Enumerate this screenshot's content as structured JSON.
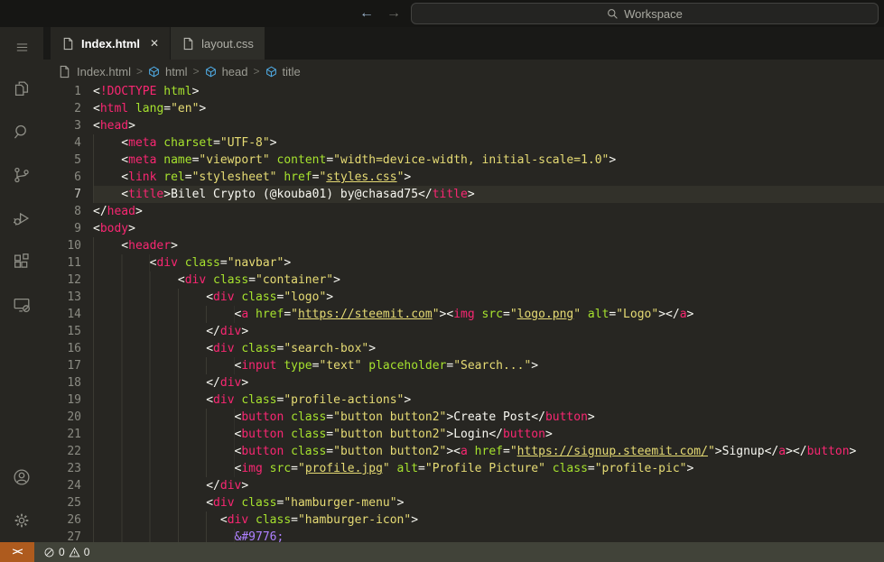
{
  "title_bar": {
    "back_glyph": "←",
    "forward_glyph": "→",
    "search_label": "Workspace"
  },
  "tabs": [
    {
      "label": "Index.html",
      "active": true,
      "icon": "file-icon",
      "close_glyph": "✕"
    },
    {
      "label": "layout.css",
      "active": false,
      "icon": "file-icon"
    }
  ],
  "breadcrumb": {
    "file": "Index.html",
    "separator": ">",
    "symbols": [
      "html",
      "head",
      "title"
    ]
  },
  "activity_bar": {
    "top_items": [
      "menu",
      "explorer",
      "search",
      "source-control",
      "run-debug",
      "extensions",
      "remote-explorer"
    ],
    "bottom_items": [
      "account",
      "settings"
    ]
  },
  "status_bar": {
    "remote_glyph": "><",
    "errors": "0",
    "warnings": "0"
  },
  "editor": {
    "current_line": 7,
    "lines": [
      {
        "n": 1,
        "indent": 0,
        "tokens": [
          [
            "p",
            "<"
          ],
          [
            "tag",
            "!DOCTYPE"
          ],
          [
            "attr",
            " html"
          ],
          [
            "p",
            ">"
          ]
        ]
      },
      {
        "n": 2,
        "indent": 0,
        "tokens": [
          [
            "p",
            "<"
          ],
          [
            "tag",
            "html"
          ],
          [
            "attr",
            " lang"
          ],
          [
            "p",
            "="
          ],
          [
            "str",
            "\"en\""
          ],
          [
            "p",
            ">"
          ]
        ]
      },
      {
        "n": 3,
        "indent": 0,
        "tokens": [
          [
            "p",
            "<"
          ],
          [
            "tag",
            "head"
          ],
          [
            "p",
            ">"
          ]
        ]
      },
      {
        "n": 4,
        "indent": 4,
        "tokens": [
          [
            "p",
            "<"
          ],
          [
            "tag",
            "meta"
          ],
          [
            "attr",
            " charset"
          ],
          [
            "p",
            "="
          ],
          [
            "str",
            "\"UTF-8\""
          ],
          [
            "p",
            ">"
          ]
        ]
      },
      {
        "n": 5,
        "indent": 4,
        "tokens": [
          [
            "p",
            "<"
          ],
          [
            "tag",
            "meta"
          ],
          [
            "attr",
            " name"
          ],
          [
            "p",
            "="
          ],
          [
            "str",
            "\"viewport\""
          ],
          [
            "attr",
            " content"
          ],
          [
            "p",
            "="
          ],
          [
            "str",
            "\"width=device-width, initial-scale=1.0\""
          ],
          [
            "p",
            ">"
          ]
        ]
      },
      {
        "n": 6,
        "indent": 4,
        "tokens": [
          [
            "p",
            "<"
          ],
          [
            "tag",
            "link"
          ],
          [
            "attr",
            " rel"
          ],
          [
            "p",
            "="
          ],
          [
            "str",
            "\"stylesheet\""
          ],
          [
            "attr",
            " href"
          ],
          [
            "p",
            "="
          ],
          [
            "str",
            "\""
          ],
          [
            "link",
            "styles.css"
          ],
          [
            "str",
            "\""
          ],
          [
            "p",
            ">"
          ]
        ]
      },
      {
        "n": 7,
        "indent": 4,
        "tokens": [
          [
            "p",
            "<"
          ],
          [
            "tag",
            "title"
          ],
          [
            "p",
            ">"
          ],
          [
            "text",
            "Bilel Crypto (@kouba01) by@chasad75"
          ],
          [
            "p",
            "</"
          ],
          [
            "tag",
            "title"
          ],
          [
            "p",
            ">"
          ]
        ]
      },
      {
        "n": 8,
        "indent": 0,
        "tokens": [
          [
            "p",
            "</"
          ],
          [
            "tag",
            "head"
          ],
          [
            "p",
            ">"
          ]
        ]
      },
      {
        "n": 9,
        "indent": 0,
        "tokens": [
          [
            "p",
            "<"
          ],
          [
            "tag",
            "body"
          ],
          [
            "p",
            ">"
          ]
        ]
      },
      {
        "n": 10,
        "indent": 4,
        "tokens": [
          [
            "p",
            "<"
          ],
          [
            "tag",
            "header"
          ],
          [
            "p",
            ">"
          ]
        ]
      },
      {
        "n": 11,
        "indent": 8,
        "tokens": [
          [
            "p",
            "<"
          ],
          [
            "tag",
            "div"
          ],
          [
            "attr",
            " class"
          ],
          [
            "p",
            "="
          ],
          [
            "str",
            "\"navbar\""
          ],
          [
            "p",
            ">"
          ]
        ]
      },
      {
        "n": 12,
        "indent": 12,
        "tokens": [
          [
            "p",
            "<"
          ],
          [
            "tag",
            "div"
          ],
          [
            "attr",
            " class"
          ],
          [
            "p",
            "="
          ],
          [
            "str",
            "\"container\""
          ],
          [
            "p",
            ">"
          ]
        ]
      },
      {
        "n": 13,
        "indent": 16,
        "tokens": [
          [
            "p",
            "<"
          ],
          [
            "tag",
            "div"
          ],
          [
            "attr",
            " class"
          ],
          [
            "p",
            "="
          ],
          [
            "str",
            "\"logo\""
          ],
          [
            "p",
            ">"
          ]
        ]
      },
      {
        "n": 14,
        "indent": 20,
        "tokens": [
          [
            "p",
            "<"
          ],
          [
            "tag",
            "a"
          ],
          [
            "attr",
            " href"
          ],
          [
            "p",
            "="
          ],
          [
            "str",
            "\""
          ],
          [
            "link",
            "https://steemit.com"
          ],
          [
            "str",
            "\""
          ],
          [
            "p",
            "><"
          ],
          [
            "tag",
            "img"
          ],
          [
            "attr",
            " src"
          ],
          [
            "p",
            "="
          ],
          [
            "str",
            "\""
          ],
          [
            "link",
            "logo.png"
          ],
          [
            "str",
            "\""
          ],
          [
            "attr",
            " alt"
          ],
          [
            "p",
            "="
          ],
          [
            "str",
            "\"Logo\""
          ],
          [
            "p",
            "></"
          ],
          [
            "tag",
            "a"
          ],
          [
            "p",
            ">"
          ]
        ]
      },
      {
        "n": 15,
        "indent": 16,
        "tokens": [
          [
            "p",
            "</"
          ],
          [
            "tag",
            "div"
          ],
          [
            "p",
            ">"
          ]
        ]
      },
      {
        "n": 16,
        "indent": 16,
        "tokens": [
          [
            "p",
            "<"
          ],
          [
            "tag",
            "div"
          ],
          [
            "attr",
            " class"
          ],
          [
            "p",
            "="
          ],
          [
            "str",
            "\"search-box\""
          ],
          [
            "p",
            ">"
          ]
        ]
      },
      {
        "n": 17,
        "indent": 20,
        "tokens": [
          [
            "p",
            "<"
          ],
          [
            "tag",
            "input"
          ],
          [
            "attr",
            " type"
          ],
          [
            "p",
            "="
          ],
          [
            "str",
            "\"text\""
          ],
          [
            "attr",
            " placeholder"
          ],
          [
            "p",
            "="
          ],
          [
            "str",
            "\"Search...\""
          ],
          [
            "p",
            ">"
          ]
        ]
      },
      {
        "n": 18,
        "indent": 16,
        "tokens": [
          [
            "p",
            "</"
          ],
          [
            "tag",
            "div"
          ],
          [
            "p",
            ">"
          ]
        ]
      },
      {
        "n": 19,
        "indent": 16,
        "tokens": [
          [
            "p",
            "<"
          ],
          [
            "tag",
            "div"
          ],
          [
            "attr",
            " class"
          ],
          [
            "p",
            "="
          ],
          [
            "str",
            "\"profile-actions\""
          ],
          [
            "p",
            ">"
          ]
        ]
      },
      {
        "n": 20,
        "indent": 20,
        "tokens": [
          [
            "p",
            "<"
          ],
          [
            "tag",
            "button"
          ],
          [
            "attr",
            " class"
          ],
          [
            "p",
            "="
          ],
          [
            "str",
            "\"button button2\""
          ],
          [
            "p",
            ">"
          ],
          [
            "text",
            "Create Post"
          ],
          [
            "p",
            "</"
          ],
          [
            "tag",
            "button"
          ],
          [
            "p",
            ">"
          ]
        ]
      },
      {
        "n": 21,
        "indent": 20,
        "tokens": [
          [
            "p",
            "<"
          ],
          [
            "tag",
            "button"
          ],
          [
            "attr",
            " class"
          ],
          [
            "p",
            "="
          ],
          [
            "str",
            "\"button button2\""
          ],
          [
            "p",
            ">"
          ],
          [
            "text",
            "Login"
          ],
          [
            "p",
            "</"
          ],
          [
            "tag",
            "button"
          ],
          [
            "p",
            ">"
          ]
        ]
      },
      {
        "n": 22,
        "indent": 20,
        "tokens": [
          [
            "p",
            "<"
          ],
          [
            "tag",
            "button"
          ],
          [
            "attr",
            " class"
          ],
          [
            "p",
            "="
          ],
          [
            "str",
            "\"button button2\""
          ],
          [
            "p",
            "><"
          ],
          [
            "tag",
            "a"
          ],
          [
            "attr",
            " href"
          ],
          [
            "p",
            "="
          ],
          [
            "str",
            "\""
          ],
          [
            "link",
            "https://signup.steemit.com/"
          ],
          [
            "str",
            "\""
          ],
          [
            "p",
            ">"
          ],
          [
            "text",
            "Signup"
          ],
          [
            "p",
            "</"
          ],
          [
            "tag",
            "a"
          ],
          [
            "p",
            "></"
          ],
          [
            "tag",
            "button"
          ],
          [
            "p",
            ">"
          ]
        ]
      },
      {
        "n": 23,
        "indent": 20,
        "tokens": [
          [
            "p",
            "<"
          ],
          [
            "tag",
            "img"
          ],
          [
            "attr",
            " src"
          ],
          [
            "p",
            "="
          ],
          [
            "str",
            "\""
          ],
          [
            "link",
            "profile.jpg"
          ],
          [
            "str",
            "\""
          ],
          [
            "attr",
            " alt"
          ],
          [
            "p",
            "="
          ],
          [
            "str",
            "\"Profile Picture\""
          ],
          [
            "attr",
            " class"
          ],
          [
            "p",
            "="
          ],
          [
            "str",
            "\"profile-pic\""
          ],
          [
            "p",
            ">"
          ]
        ]
      },
      {
        "n": 24,
        "indent": 16,
        "tokens": [
          [
            "p",
            "</"
          ],
          [
            "tag",
            "div"
          ],
          [
            "p",
            ">"
          ]
        ]
      },
      {
        "n": 25,
        "indent": 16,
        "tokens": [
          [
            "p",
            "<"
          ],
          [
            "tag",
            "div"
          ],
          [
            "attr",
            " class"
          ],
          [
            "p",
            "="
          ],
          [
            "str",
            "\"hamburger-menu\""
          ],
          [
            "p",
            ">"
          ]
        ]
      },
      {
        "n": 26,
        "indent": 18,
        "tokens": [
          [
            "p",
            "<"
          ],
          [
            "tag",
            "div"
          ],
          [
            "attr",
            " class"
          ],
          [
            "p",
            "="
          ],
          [
            "str",
            "\"hamburger-icon\""
          ],
          [
            "p",
            ">"
          ]
        ]
      },
      {
        "n": 27,
        "indent": 20,
        "tokens": [
          [
            "ent",
            "&#9776;"
          ]
        ]
      }
    ]
  },
  "colors": {
    "bg": "#272622",
    "linehl": "#32312a",
    "titlebar": "#161614",
    "tabstrip": "#191917",
    "tabActive": "#272622",
    "tabInactive": "#2e2e29",
    "tabTextActive": "#ffffff",
    "tabTextInactive": "#aeaea6",
    "breadcrumbText": "#9b9b93",
    "activityIcon": "#8f8f87",
    "symbolBlue": "#4fa8e0",
    "statusbar": "#414339",
    "statusText": "#f2f2ee",
    "remoteBg": "#ae5b1e",
    "ccBg": "#242422",
    "ccBorder": "#434340",
    "ccText": "#a9a9a1",
    "backArrow": "#9db6cf",
    "fwdArrow": "#6f6f69",
    "gutter": "#8b8b83",
    "gutterActive": "#c6c6c0",
    "guide": "#3b3a33",
    "punct": "#f8f8f2",
    "tag": "#f92672",
    "attr": "#a6e22e",
    "str": "#e6db74",
    "text": "#f8f8f2",
    "ent": "#ae81ff"
  }
}
